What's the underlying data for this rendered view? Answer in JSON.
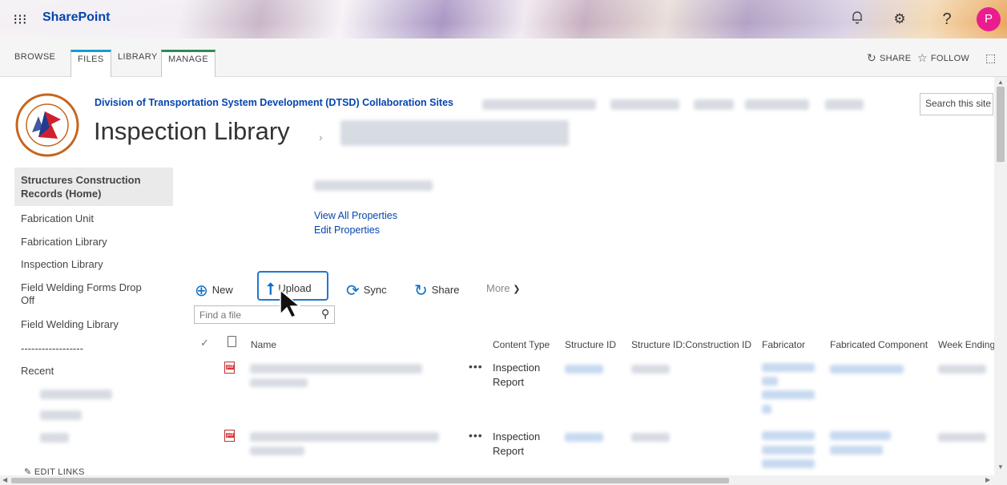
{
  "suitebar": {
    "brand": "SharePoint",
    "avatar_initial": "P",
    "icons": [
      "waffle-icon",
      "bell-icon",
      "gear-icon",
      "help-icon"
    ]
  },
  "ribbon": {
    "tabs": [
      "BROWSE",
      "FILES",
      "LIBRARY",
      "MANAGE"
    ],
    "share_label": "SHARE",
    "follow_label": "FOLLOW"
  },
  "header": {
    "site_link": "Division of Transportation System Development (DTSD) Collaboration Sites",
    "title": "Inspection Library",
    "breadcrumb_separator": "›",
    "search_placeholder": "Search this site",
    "logo_text": "WISCONSIN DEPARTMENT OF TRANSPORTATION"
  },
  "nav": {
    "home": "Structures Construction Records (Home)",
    "items": [
      "Fabrication Unit",
      "Fabrication Library",
      "Inspection Library",
      "Field Welding Forms Drop Off",
      "Field Welding Library"
    ],
    "divider": "------------------",
    "recent": "Recent",
    "edit_links": "EDIT LINKS"
  },
  "properties": {
    "view_all": "View All Properties",
    "edit": "Edit Properties"
  },
  "commands": {
    "new": "New",
    "upload": "Upload",
    "sync": "Sync",
    "share": "Share",
    "more": "More"
  },
  "find": {
    "placeholder": "Find a file"
  },
  "columns": [
    "Name",
    "Content Type",
    "Structure ID",
    "Structure ID:Construction ID",
    "Fabricator",
    "Fabricated Component",
    "Week Ending"
  ],
  "rows": [
    {
      "content_type_line1": "Inspection",
      "content_type_line2": "Report"
    },
    {
      "content_type_line1": "Inspection",
      "content_type_line2": "Report"
    }
  ],
  "colors": {
    "accent": "#0645ad",
    "command_icon": "#0b6ec3",
    "avatar": "#ea1d8e",
    "upload_border": "#1f78d1"
  }
}
